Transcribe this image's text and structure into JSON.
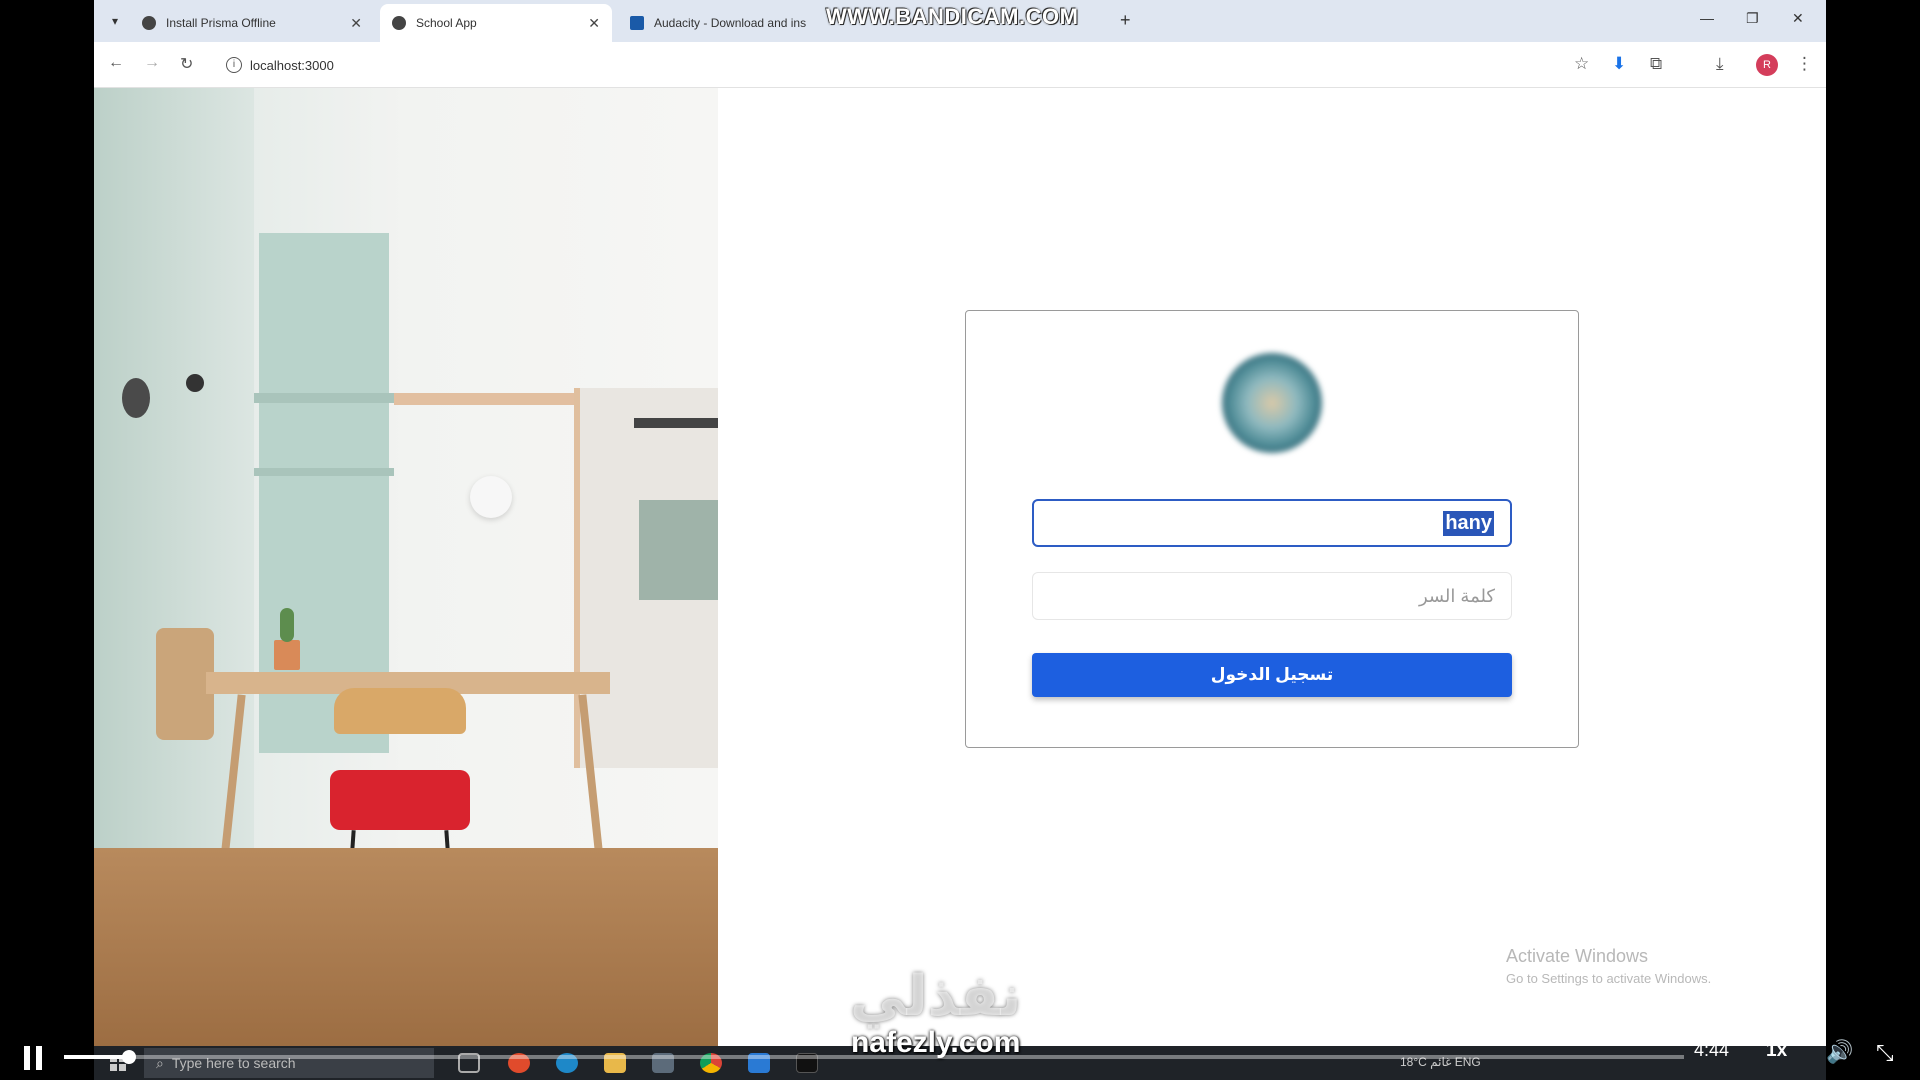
{
  "browser": {
    "tabs": [
      {
        "label": "Install Prisma Offline",
        "active": false
      },
      {
        "label": "School App",
        "active": true
      },
      {
        "label": "Audacity - Download and ins",
        "active": false
      }
    ],
    "new_tab_symbol": "+",
    "url": "localhost:3000",
    "avatar_initial": "R",
    "recorder_watermark": "WWW.BANDICAM.COM"
  },
  "login": {
    "username_value": "hany",
    "password_placeholder": "كلمة السر",
    "submit_label": "تسجيل الدخول"
  },
  "os": {
    "activate_title": "Activate Windows",
    "activate_sub": "Go to Settings to activate Windows.",
    "search_placeholder": "Type here to search",
    "tray_text": "18°C  غائم  ENG"
  },
  "video": {
    "time": "4:44",
    "speed": "1x",
    "progress": 0.04
  },
  "watermark": {
    "arabic": "نفذلي",
    "domain": "nafezly.com"
  },
  "colors": {
    "primary_button": "#1d5fe0",
    "input_focus_border": "#2d5cc4",
    "selection": "#2a56b8"
  }
}
